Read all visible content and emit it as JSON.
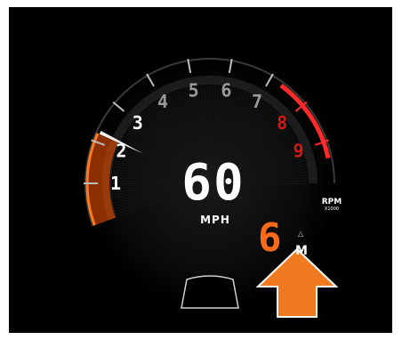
{
  "speed": {
    "value": "60",
    "unit": "MPH"
  },
  "rpm": {
    "label": "RPM",
    "multiplier": "X1000",
    "current_fraction": 0.22,
    "redline_from": 7.3
  },
  "tachometer_ticks": [
    "1",
    "2",
    "3",
    "4",
    "5",
    "6",
    "7",
    "8",
    "9"
  ],
  "gear": {
    "value": "6",
    "mode": "M",
    "upshift_indicator": "△"
  },
  "hint_arrow": {
    "direction": "up",
    "color": "#f07a1f"
  },
  "colors": {
    "background": "#000000",
    "tick_label": "#9a9a9a",
    "tick_label_active": "#ffffff",
    "tick_label_redline": "#d11a1a",
    "gear": "#ff6a1a",
    "redline": "#ff2a2a"
  }
}
